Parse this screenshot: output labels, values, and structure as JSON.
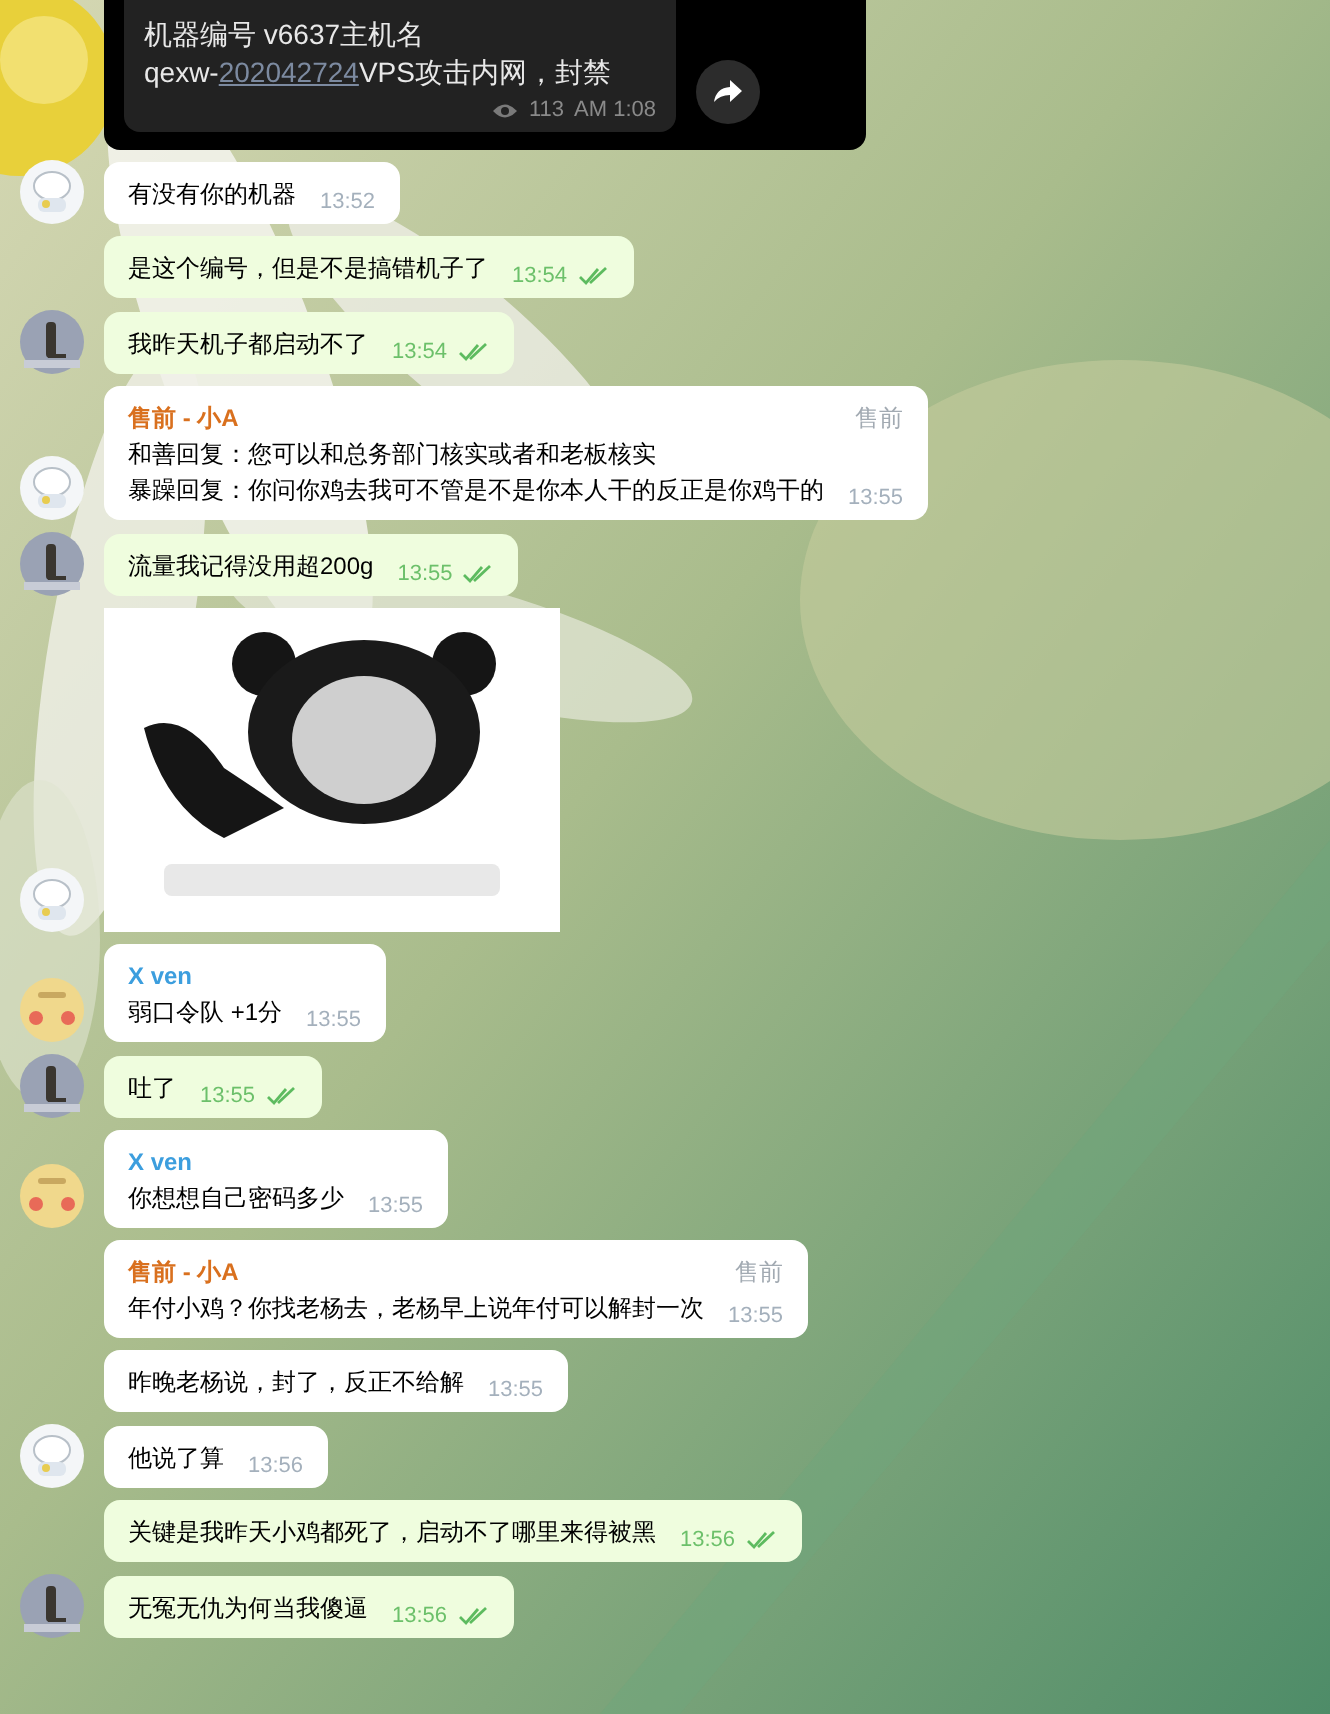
{
  "forwarded": {
    "line_1": "机器编号  v6637主机名",
    "line_2_prefix": "qexw-",
    "link": "202042724",
    "line_2_suffix": "VPS攻击内网，封禁",
    "views": "113",
    "time": "AM 1:08"
  },
  "messages": [
    {
      "kind": "text",
      "outgoing": false,
      "avatar": {
        "kind": "sheep"
      },
      "lines": [
        "有没有你的机器"
      ],
      "time": "13:52"
    },
    {
      "kind": "text",
      "outgoing": true,
      "lines": [
        "是这个编号，但是不是搞错机子了"
      ],
      "time": "13:54"
    },
    {
      "kind": "text",
      "outgoing": true,
      "avatar": {
        "kind": "person"
      },
      "lines": [
        "我昨天机子都启动不了"
      ],
      "time": "13:54"
    },
    {
      "kind": "text",
      "outgoing": false,
      "avatar": {
        "kind": "sheep"
      },
      "sender": {
        "name": "售前 - 小A",
        "color": "#d9701e"
      },
      "role": "售前",
      "lines": [
        "和善回复：您可以和总务部门核实或者和老板核实",
        "暴躁回复：你问你鸡去我可不管是不是你本人干的反正是你鸡干的"
      ],
      "time": "13:55"
    },
    {
      "kind": "text",
      "outgoing": true,
      "avatar": {
        "kind": "person"
      },
      "lines": [
        "流量我记得没用超200g"
      ],
      "time": "13:55"
    },
    {
      "kind": "sticker",
      "avatar": {
        "kind": "sheep"
      }
    },
    {
      "kind": "text",
      "outgoing": false,
      "avatar": {
        "kind": "xven"
      },
      "sender": {
        "name": "X ven",
        "color": "#3c9ede"
      },
      "lines": [
        "弱口令队 +1分"
      ],
      "time": "13:55"
    },
    {
      "kind": "text",
      "outgoing": true,
      "avatar": {
        "kind": "person"
      },
      "lines": [
        "吐了"
      ],
      "time": "13:55"
    },
    {
      "kind": "text",
      "outgoing": false,
      "avatar": {
        "kind": "xven"
      },
      "sender": {
        "name": "X ven",
        "color": "#3c9ede"
      },
      "lines": [
        "你想想自己密码多少"
      ],
      "time": "13:55"
    },
    {
      "kind": "text",
      "outgoing": false,
      "sender": {
        "name": "售前 - 小A",
        "color": "#d9701e"
      },
      "role": "售前",
      "lines": [
        "年付小鸡？你找老杨去，老杨早上说年付可以解封一次"
      ],
      "time": "13:55"
    },
    {
      "kind": "text",
      "outgoing": false,
      "lines": [
        "昨晚老杨说，封了，反正不给解"
      ],
      "time": "13:55"
    },
    {
      "kind": "text",
      "outgoing": false,
      "avatar": {
        "kind": "sheep"
      },
      "lines": [
        "他说了算"
      ],
      "time": "13:56"
    },
    {
      "kind": "text",
      "outgoing": true,
      "lines": [
        "关键是我昨天小鸡都死了，启动不了哪里来得被黑"
      ],
      "time": "13:56"
    },
    {
      "kind": "text",
      "outgoing": true,
      "avatar": {
        "kind": "person"
      },
      "lines": [
        "无冤无仇为何当我傻逼"
      ],
      "time": "13:56"
    }
  ]
}
